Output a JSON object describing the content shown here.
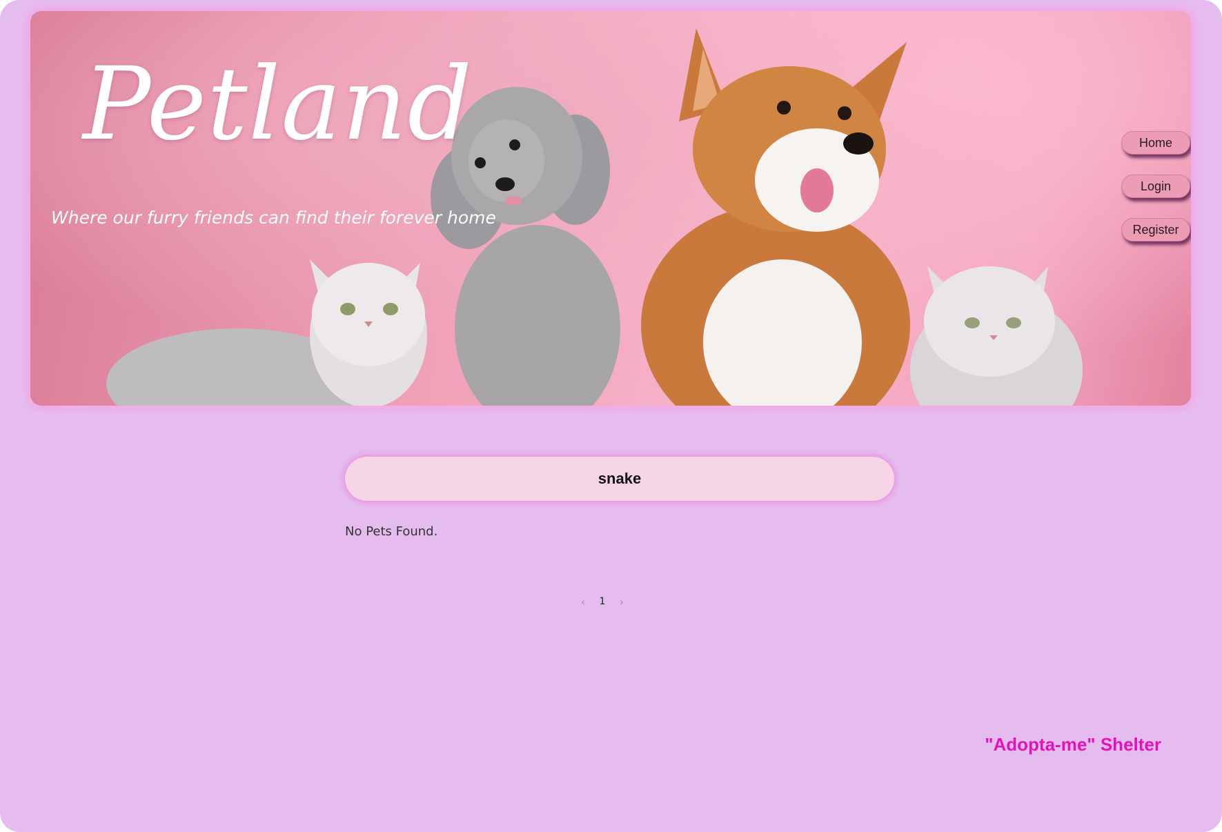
{
  "header": {
    "brand": "Petland",
    "tagline": "Where our furry friends can find their forever home"
  },
  "nav": {
    "items": [
      {
        "label": "Home"
      },
      {
        "label": "Login"
      },
      {
        "label": "Register"
      }
    ]
  },
  "search": {
    "value": "snake"
  },
  "results": {
    "empty_message": "No Pets Found."
  },
  "pagination": {
    "prev_icon": "chevron-left-icon",
    "current_page": "1",
    "next_icon": "chevron-right-icon"
  },
  "footer": {
    "shelter_name": "\"Adopta-me\" Shelter"
  },
  "colors": {
    "page_background": "#e4bdee",
    "banner_pink": "#f3a6bf",
    "search_box": "#f5d5e6",
    "footer_accent": "#e312b9"
  }
}
